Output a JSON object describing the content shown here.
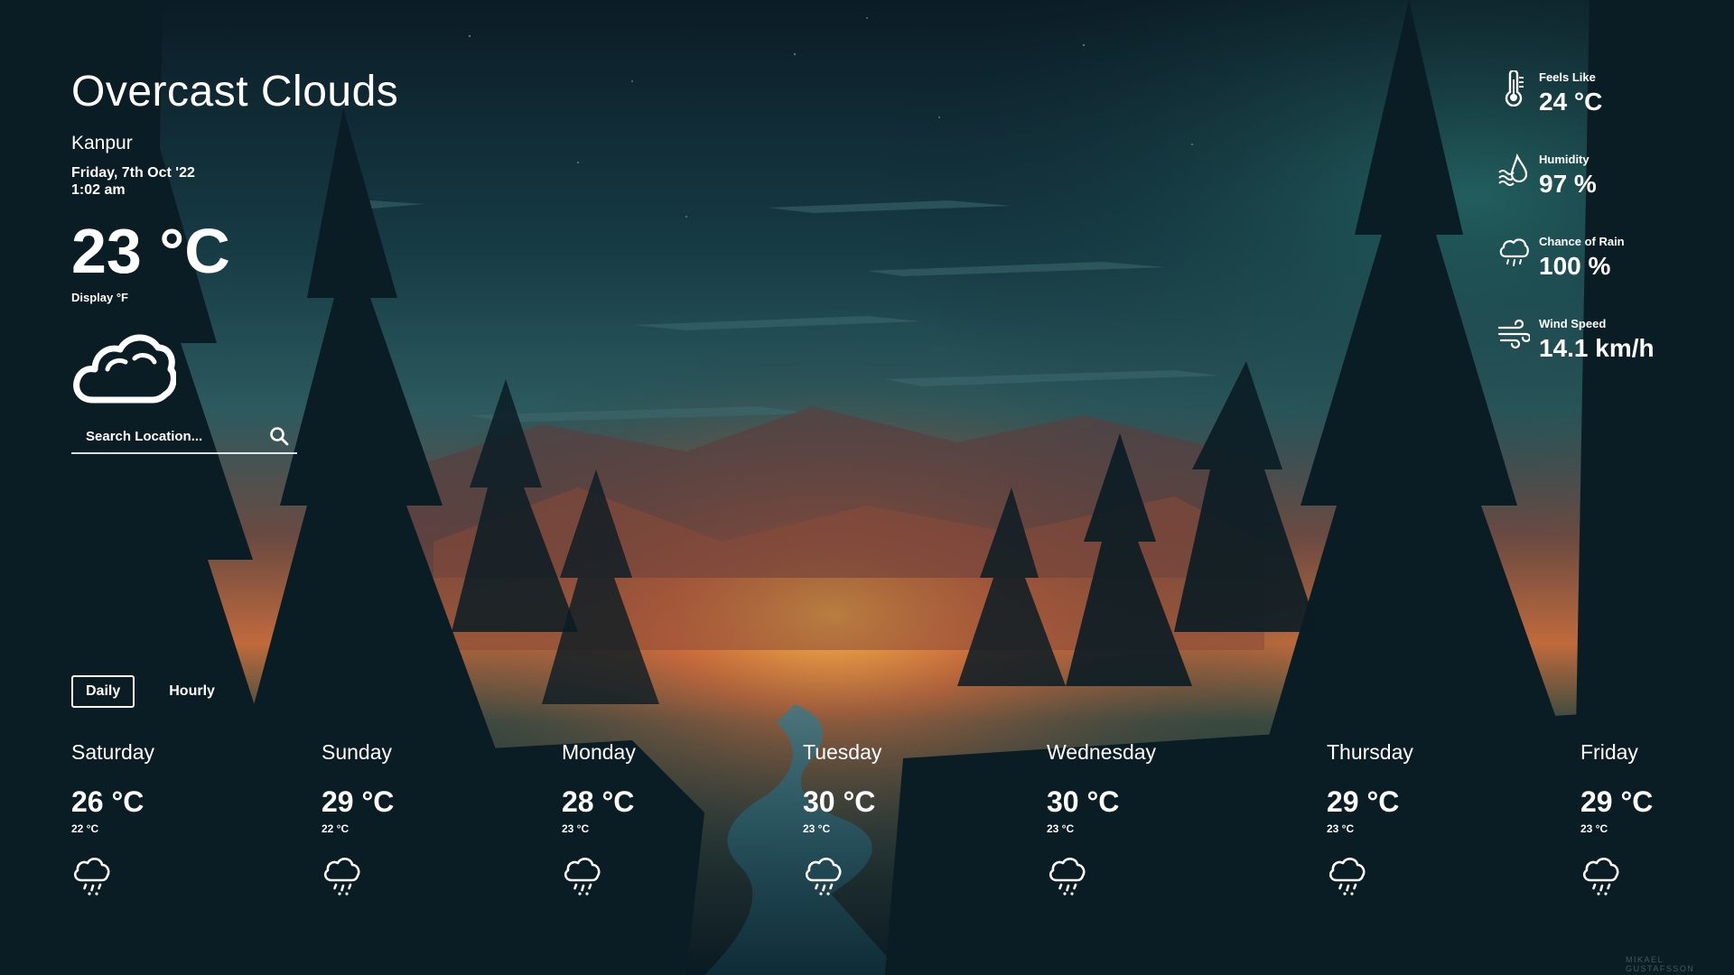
{
  "current": {
    "condition": "Overcast Clouds",
    "city": "Kanpur",
    "date": "Friday, 7th Oct '22",
    "time": "1:02 am",
    "temperature": "23 °C",
    "unit_toggle": "Display °F",
    "icon": "cloud-icon"
  },
  "search": {
    "placeholder": "Search Location...",
    "value": "",
    "icon": "search-icon"
  },
  "stats": [
    {
      "label": "Feels Like",
      "value": "24 °C",
      "icon": "thermometer-icon"
    },
    {
      "label": "Humidity",
      "value": "97 %",
      "icon": "humidity-icon"
    },
    {
      "label": "Chance of Rain",
      "value": "100 %",
      "icon": "rain-cloud-icon"
    },
    {
      "label": "Wind Speed",
      "value": "14.1 km/h",
      "icon": "wind-icon"
    }
  ],
  "tabs": {
    "daily": "Daily",
    "hourly": "Hourly",
    "active": "Daily"
  },
  "forecast": [
    {
      "day": "Saturday",
      "high": "26 °C",
      "low": "22 °C",
      "icon": "rain-icon"
    },
    {
      "day": "Sunday",
      "high": "29 °C",
      "low": "22 °C",
      "icon": "rain-icon"
    },
    {
      "day": "Monday",
      "high": "28 °C",
      "low": "23 °C",
      "icon": "rain-icon"
    },
    {
      "day": "Tuesday",
      "high": "30 °C",
      "low": "23 °C",
      "icon": "rain-icon"
    },
    {
      "day": "Wednesday",
      "high": "30 °C",
      "low": "23 °C",
      "icon": "rain-icon"
    },
    {
      "day": "Thursday",
      "high": "29 °C",
      "low": "23 °C",
      "icon": "rain-icon"
    },
    {
      "day": "Friday",
      "high": "29 °C",
      "low": "23 °C",
      "icon": "rain-icon"
    }
  ],
  "credit": "MIKAEL GUSTAFSSON",
  "colors": {
    "sky_top": "#0d2a33",
    "sky_mid": "#1e4a52",
    "glow": "#e8a642",
    "glow_red": "#c2503a",
    "forest_dark": "#081820",
    "text": "#ffffff"
  }
}
